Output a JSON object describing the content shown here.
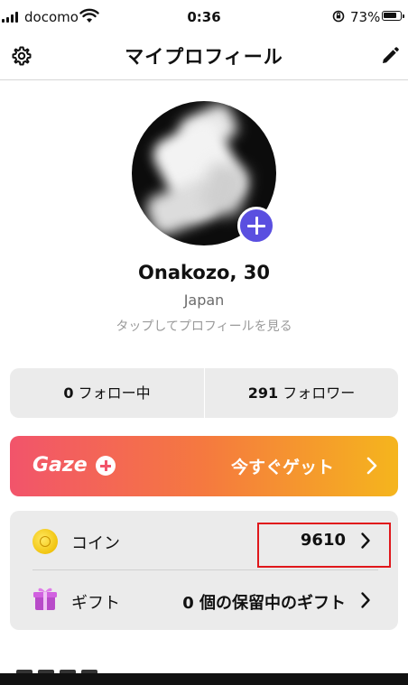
{
  "status_bar": {
    "carrier": "docomo",
    "time": "0:36",
    "battery": "73%"
  },
  "header": {
    "title": "マイプロフィール",
    "left_icon": "gear-icon",
    "right_icon": "pencil-icon"
  },
  "profile": {
    "name": "Onakozo, 30",
    "country": "Japan",
    "view_link": "タップしてプロフィールを見る",
    "add_photo_icon": "plus-icon"
  },
  "follow": {
    "following_count": "0",
    "following_label": "フォロー中",
    "followers_count": "291",
    "followers_label": "フォロワー"
  },
  "gaze_plus": {
    "logo": "Gaze",
    "cta": "今すぐゲット",
    "colors": [
      "#f2546b",
      "#f5793f",
      "#f5b51d"
    ]
  },
  "wallet": {
    "coin_label": "コイン",
    "coin_value": "9610",
    "gift_label": "ギフト",
    "gift_value": "0 個の保留中のギフト"
  },
  "colors": {
    "accent": "#5a4fe0",
    "highlight": "#e0171b",
    "card_bg": "#ebebeb"
  }
}
